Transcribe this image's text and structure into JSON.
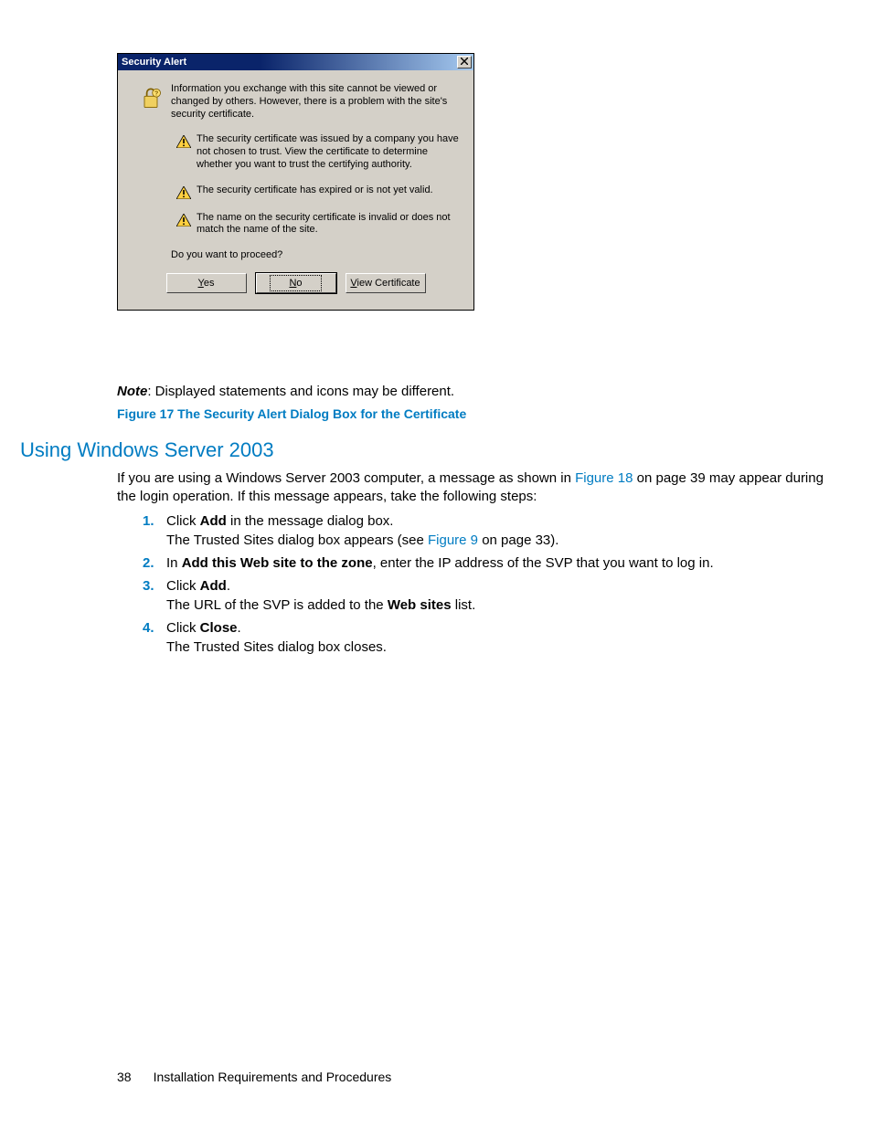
{
  "dialog": {
    "title": "Security Alert",
    "close_label": "✕",
    "main_text": "Information you exchange with this site cannot be viewed or changed by others. However, there is a problem with the site's security certificate.",
    "warn1": "The security certificate was issued by a company you have not chosen to trust. View the certificate to determine whether you want to trust the certifying authority.",
    "warn2": "The security certificate has expired or is not yet valid.",
    "warn3": "The name on the security certificate is invalid or does not match the name of the site.",
    "question": "Do you want to proceed?",
    "btn_yes": "Yes",
    "btn_no": "No",
    "btn_view": "View Certificate"
  },
  "note": {
    "label": "Note",
    "text": ":  Displayed statements and icons may be different."
  },
  "figure_caption": "Figure 17 The Security Alert Dialog Box for the Certificate",
  "section_heading": "Using Windows Server 2003",
  "intro_a": "If you are using a Windows Server 2003 computer, a message as shown in ",
  "intro_link1": "Figure 18",
  "intro_b": " on page 39 may appear during the login operation.  If this message appears, take the following steps:",
  "steps": [
    {
      "num": "1.",
      "a": "Click ",
      "bold1": "Add",
      "b": " in the message dialog box.",
      "line2a": "The Trusted Sites dialog box appears (see ",
      "line2link": "Figure 9",
      "line2b": " on page 33)."
    },
    {
      "num": "2.",
      "a": "In ",
      "bold1": "Add this Web site to the zone",
      "b": ", enter the IP address of the SVP that you want to log in."
    },
    {
      "num": "3.",
      "a": "Click ",
      "bold1": "Add",
      "b": ".",
      "line2a": "The URL of the SVP is added to the ",
      "line2bold": "Web sites",
      "line2b": " list."
    },
    {
      "num": "4.",
      "a": "Click ",
      "bold1": "Close",
      "b": ".",
      "line2a": "The Trusted Sites dialog box closes."
    }
  ],
  "footer": {
    "page": "38",
    "title": "Installation Requirements and Procedures"
  }
}
